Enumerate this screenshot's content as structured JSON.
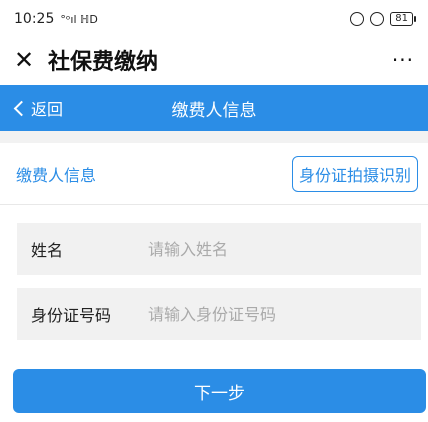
{
  "status_bar": {
    "time": "10:25",
    "signal": "°ᵒıl ℍD",
    "battery": "81"
  },
  "top_bar": {
    "title": "社保费缴纳",
    "close_glyph": "✕",
    "more_glyph": "···"
  },
  "nav": {
    "back_label": "返回",
    "title": "缴费人信息"
  },
  "section": {
    "title": "缴费人信息",
    "ocr_button_label": "身份证拍摄识别"
  },
  "form": {
    "name": {
      "label": "姓名",
      "value": "",
      "placeholder": "请输入姓名"
    },
    "id_number": {
      "label": "身份证号码",
      "value": "",
      "placeholder": "请输入身份证号码"
    }
  },
  "actions": {
    "next_label": "下一步"
  },
  "colors": {
    "accent": "#2b8de6",
    "field_bg": "#f1f1f1",
    "placeholder": "#aaaaaa"
  }
}
